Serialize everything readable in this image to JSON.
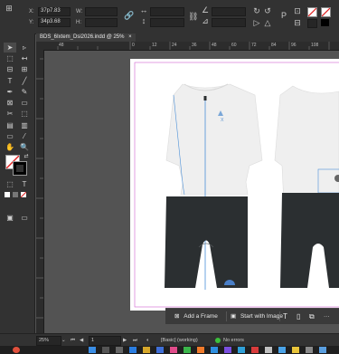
{
  "control_bar": {
    "x_label": "X:",
    "x_value": "37p7.83",
    "y_label": "Y:",
    "y_value": "34p3.68",
    "w_label": "W:",
    "h_label": "H:"
  },
  "document": {
    "tab_label": "BDS_6Ixtem_Dsi2026.indd @ 25%",
    "close_glyph": "×"
  },
  "ruler": {
    "ticks": [
      "48",
      "0",
      "12",
      "24",
      "36",
      "48",
      "60",
      "72",
      "84",
      "96",
      "108"
    ]
  },
  "contextual_task_bar": {
    "add_frame_label": "Add a Frame",
    "start_with_image_label": "Start with Image",
    "more_glyph": "···"
  },
  "status_bar": {
    "zoom": "25%",
    "page": "1",
    "style": "[Basic] (working)",
    "errors": "No errors"
  },
  "colors": {
    "ui_dark": "#323232",
    "pasteboard": "#535353",
    "jersey": "#efefef",
    "bib": "#2b2f31",
    "seam": "#4a8fd8",
    "margin_guide": "#d060d0"
  }
}
